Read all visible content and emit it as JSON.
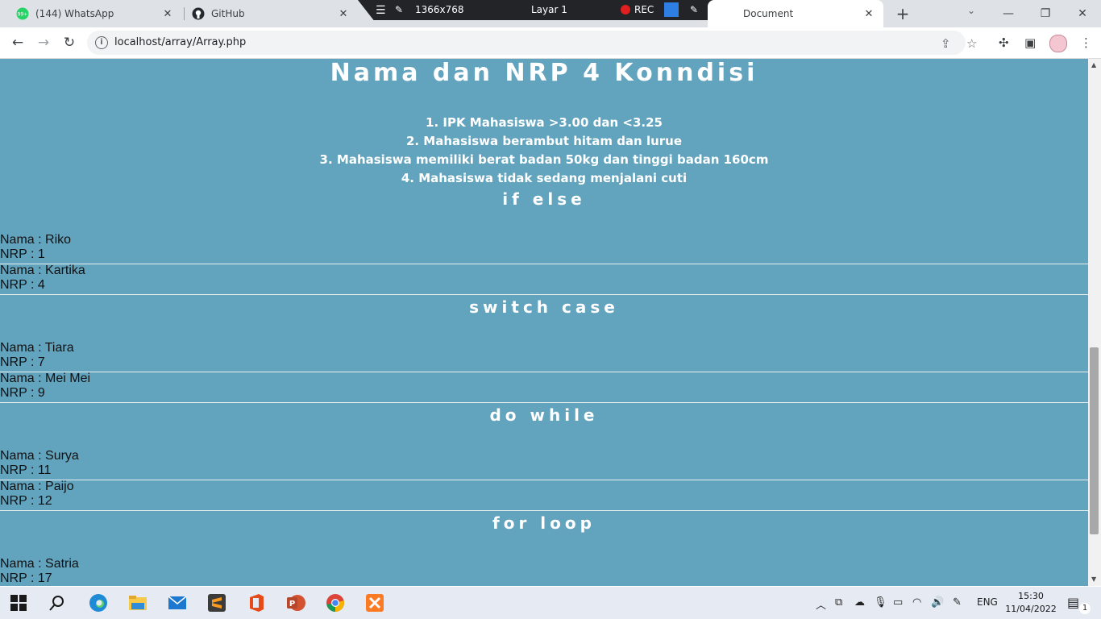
{
  "browser": {
    "tabs": [
      {
        "title": "(144) WhatsApp",
        "favicon": "whatsapp-icon"
      },
      {
        "title": "GitHub",
        "favicon": "github-icon"
      },
      {
        "title": "Document",
        "favicon": "document-icon"
      }
    ],
    "url": "localhost/array/Array.php"
  },
  "recorder": {
    "resolution": "1366x768",
    "layer": "Layar 1",
    "rec_label": "REC"
  },
  "page": {
    "title": "Nama dan NRP 4 Konndisi",
    "conditions": [
      "1. IPK Mahasiswa >3.00 dan <3.25",
      "2. Mahasiswa berambut hitam dan lurue",
      "3. Mahasiswa memiliki berat badan 50kg dan tinggi badan 160cm",
      "4. Mahasiswa tidak sedang menjalani cuti"
    ],
    "sections": [
      {
        "heading": "if else",
        "records": [
          {
            "nama": "Nama : Riko",
            "nrp": "NRP : 1"
          },
          {
            "nama": "Nama : Kartika",
            "nrp": "NRP : 4"
          }
        ]
      },
      {
        "heading": "switch case",
        "records": [
          {
            "nama": "Nama : Tiara",
            "nrp": "NRP : 7"
          },
          {
            "nama": "Nama : Mei Mei",
            "nrp": "NRP : 9"
          }
        ]
      },
      {
        "heading": "do while",
        "records": [
          {
            "nama": "Nama : Surya",
            "nrp": "NRP : 11"
          },
          {
            "nama": "Nama : Paijo",
            "nrp": "NRP : 12"
          }
        ]
      },
      {
        "heading": "for loop",
        "records": [
          {
            "nama": "Nama : Satria",
            "nrp": "NRP : 17"
          }
        ]
      }
    ]
  },
  "taskbar": {
    "language": "ENG",
    "time": "15:30",
    "date": "11/04/2022",
    "notification_count": "1"
  },
  "colors": {
    "page_background": "#62a3be",
    "heading_text": "#ffffff"
  }
}
